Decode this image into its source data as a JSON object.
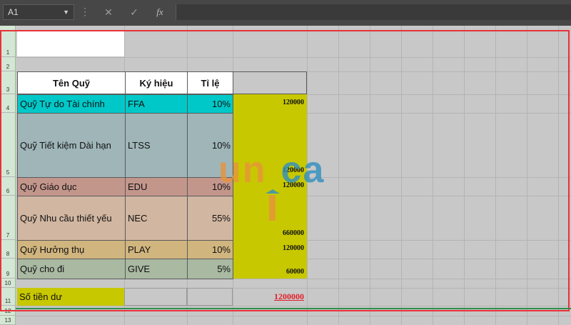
{
  "toolbar": {
    "name_box": "A1",
    "formula_value": ""
  },
  "rows": [
    "1",
    "2",
    "3",
    "4",
    "5",
    "6",
    "7",
    "8",
    "9",
    "10",
    "11",
    "12",
    "13"
  ],
  "table": {
    "headers": {
      "name": "Tên Quỹ",
      "code": "Ký hiệu",
      "rate": "Tỉ lệ"
    },
    "items": [
      {
        "name": "Quỹ Tự do Tài chính",
        "code": "FFA",
        "rate": "10%",
        "amount": "120000",
        "color": "#00c8c8"
      },
      {
        "name": "Quỹ Tiết kiệm Dài hạn",
        "code": "LTSS",
        "rate": "10%",
        "amount": "120000",
        "color": "#9fb5b8"
      },
      {
        "name": "Quỹ Giáo dục",
        "code": "EDU",
        "rate": "10%",
        "amount": "120000",
        "color": "#c3968c"
      },
      {
        "name": "Quỹ Nhu cầu thiết yếu",
        "code": "NEC",
        "rate": "55%",
        "amount": "660000",
        "color": "#d1b6a1"
      },
      {
        "name": "Quỹ Hưởng thụ",
        "code": "PLAY",
        "rate": "10%",
        "amount": "120000",
        "color": "#d1b57f"
      },
      {
        "name": "Quỹ cho đi",
        "code": "GIVE",
        "rate": "5%",
        "amount": "60000",
        "color": "#a9b9a2"
      }
    ],
    "amount_color": "#c8c800",
    "balance_label": "Số tiền dư",
    "balance_value": "1200000",
    "balance_color": "#e0202a"
  },
  "watermark": {
    "part1": "un",
    "part2": "ca",
    "part1_color": "#e8943a",
    "part2_color": "#2f8fc0"
  }
}
